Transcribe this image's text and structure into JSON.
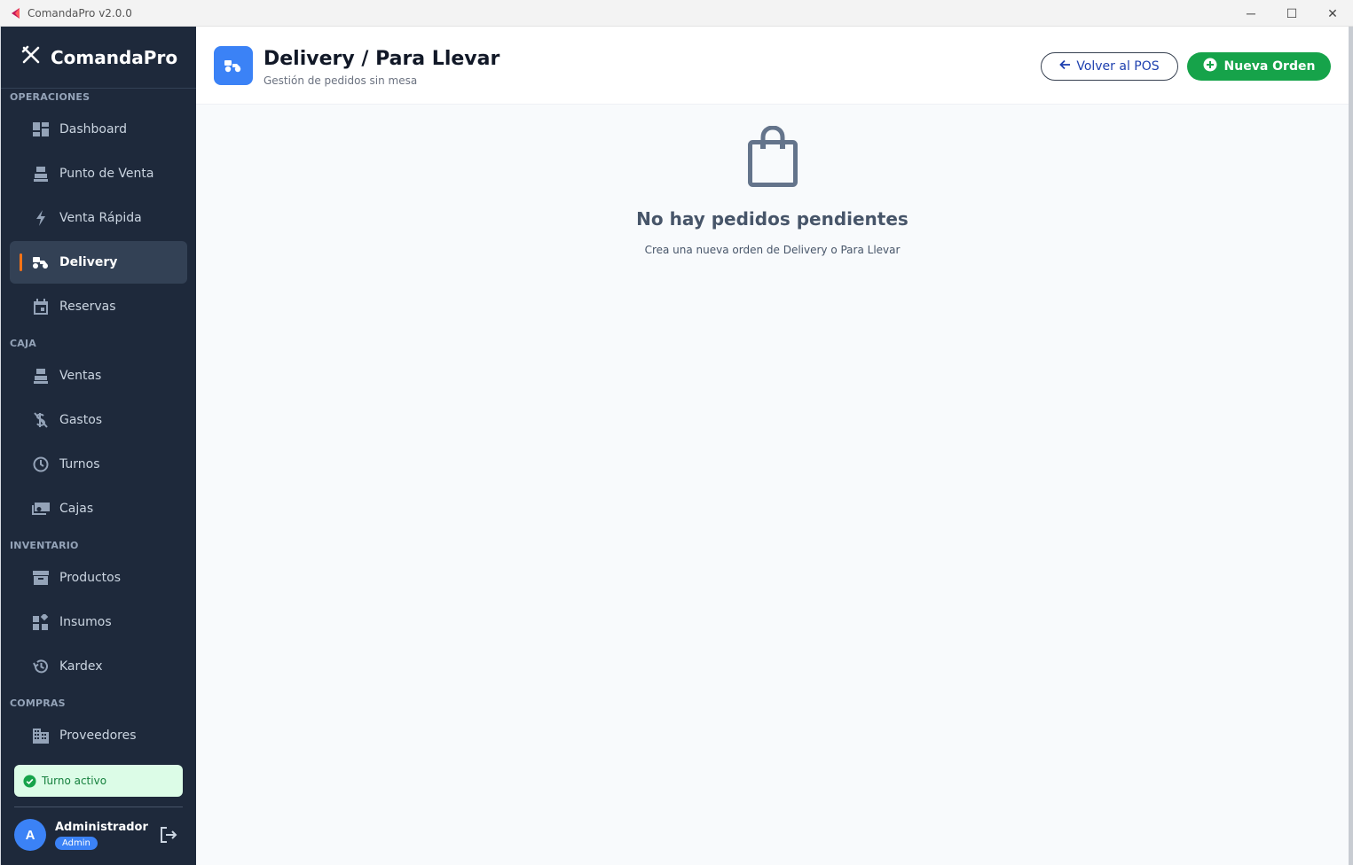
{
  "window": {
    "title": "ComandaPro v2.0.0",
    "controls": {
      "minimize": "─",
      "maximize": "☐",
      "close": "✕"
    }
  },
  "sidebar": {
    "brand": "ComandaPro",
    "sections": [
      {
        "label": "OPERACIONES",
        "items": [
          {
            "label": "Dashboard",
            "icon": "dashboard-icon"
          },
          {
            "label": "Punto de Venta",
            "icon": "register-icon"
          },
          {
            "label": "Venta Rápida",
            "icon": "lightning-icon"
          },
          {
            "label": "Delivery",
            "icon": "scooter-icon",
            "active": true
          },
          {
            "label": "Reservas",
            "icon": "calendar-icon"
          }
        ]
      },
      {
        "label": "CAJA",
        "items": [
          {
            "label": "Ventas",
            "icon": "register-icon"
          },
          {
            "label": "Gastos",
            "icon": "money-off-icon"
          },
          {
            "label": "Turnos",
            "icon": "clock-icon"
          },
          {
            "label": "Cajas",
            "icon": "cash-icon"
          }
        ]
      },
      {
        "label": "INVENTARIO",
        "items": [
          {
            "label": "Productos",
            "icon": "archive-icon"
          },
          {
            "label": "Insumos",
            "icon": "widgets-icon"
          },
          {
            "label": "Kardex",
            "icon": "history-icon"
          }
        ]
      },
      {
        "label": "COMPRAS",
        "items": [
          {
            "label": "Proveedores",
            "icon": "building-icon"
          }
        ]
      }
    ],
    "shift_status": "Turno activo",
    "user": {
      "initial": "A",
      "name": "Administrador",
      "role": "Admin"
    }
  },
  "header": {
    "title": "Delivery / Para Llevar",
    "subtitle": "Gestión de pedidos sin mesa",
    "back_button": "Volver al POS",
    "new_button": "Nueva Orden"
  },
  "empty_state": {
    "title": "No hay pedidos pendientes",
    "subtitle": "Crea una nueva orden de Delivery o Para Llevar"
  },
  "colors": {
    "sidebar_bg": "#1e293b",
    "accent_blue": "#3b82f6",
    "accent_green": "#16a34a",
    "active_indicator": "#f97316"
  }
}
